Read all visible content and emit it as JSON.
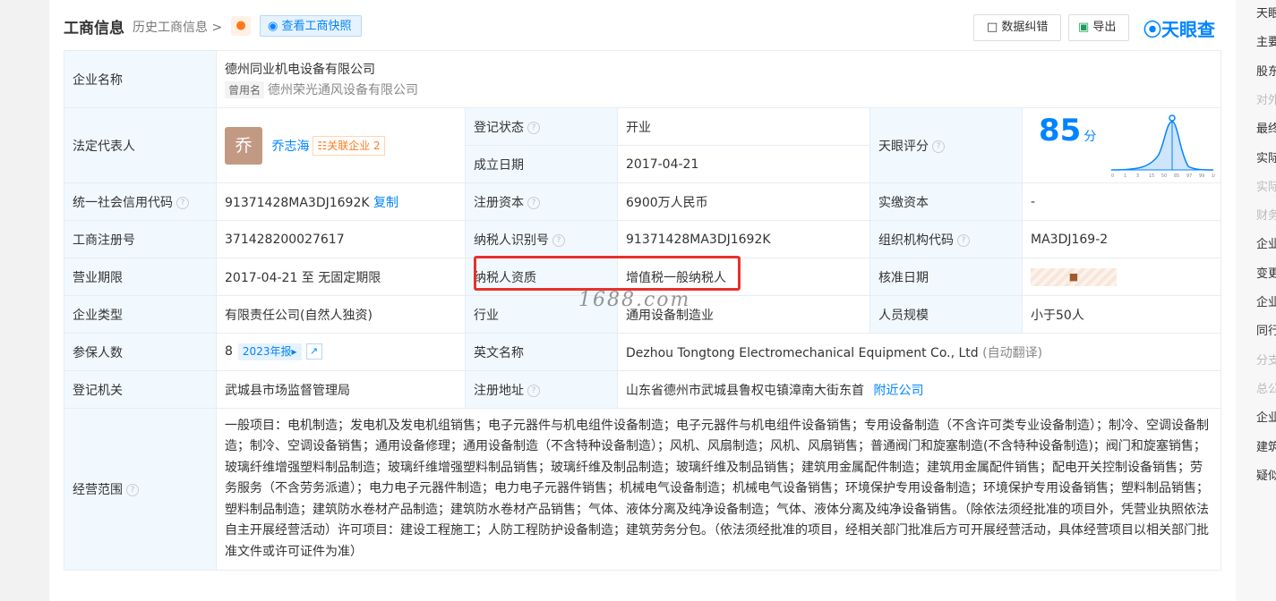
{
  "header": {
    "title": "工商信息",
    "history": "历史工商信息 >",
    "snapshot_label": "查看工商快照",
    "correction_label": "数据纠错",
    "export_label": "导出",
    "brand": "天眼查"
  },
  "company": {
    "name_label": "企业名称",
    "name": "德州同业机电设备有限公司",
    "former_tag": "曾用名",
    "former_name": "德州荣光通风设备有限公司",
    "legal_rep_label": "法定代表人",
    "legal_rep_avatar": "乔",
    "legal_rep": "乔志海",
    "assoc_label": "关联企业 2",
    "status_label": "登记状态",
    "status": "开业",
    "found_label": "成立日期",
    "found": "2017-04-21",
    "score_label": "天眼评分",
    "score": "85",
    "score_unit": "分",
    "credit_label": "统一社会信用代码",
    "credit": "91371428MA3DJ1692K",
    "copy": "复制",
    "capital_label": "注册资本",
    "capital": "6900万人民币",
    "paid_label": "实缴资本",
    "paid": "-",
    "reg_no_label": "工商注册号",
    "reg_no": "371428200027617",
    "tax_id_label": "纳税人识别号",
    "tax_id": "91371428MA3DJ1692K",
    "org_code_label": "组织机构代码",
    "org_code": "MA3DJ169-2",
    "term_label": "营业期限",
    "term": "2017-04-21 至 无固定期限",
    "taxpayer_label": "纳税人资质",
    "taxpayer": "增值税一般纳税人",
    "approve_label": "核准日期",
    "type_label": "企业类型",
    "type": "有限责任公司(自然人独资)",
    "industry_label": "行业",
    "industry": "通用设备制造业",
    "staff_label": "人员规模",
    "staff": "小于50人",
    "insured_label": "参保人数",
    "insured": "8",
    "year_report": "2023年报",
    "en_label": "英文名称",
    "en_name": "Dezhou Tongtong Electromechanical Equipment Co., Ltd",
    "auto_translate": "(自动翻译)",
    "authority_label": "登记机关",
    "authority": "武城县市场监督管理局",
    "address_label": "注册地址",
    "address": "山东省德州市武城县鲁权屯镇漳南大街东首",
    "nearby": "附近公司",
    "scope_label": "经营范围",
    "scope": "一般项目：电机制造；发电机及发电机组销售；电子元器件与机电组件设备制造；电子元器件与机电组件设备销售；专用设备制造（不含许可类专业设备制造）；制冷、空调设备制造；制冷、空调设备销售；通用设备修理；通用设备制造（不含特种设备制造）；风机、风扇制造；风机、风扇销售；普通阀门和旋塞制造(不含特种设备制造)；阀门和旋塞销售；玻璃纤维增强塑料制品制造；玻璃纤维增强塑料制品销售；玻璃纤维及制品制造；玻璃纤维及制品销售；建筑用金属配件制造；建筑用金属配件销售；配电开关控制设备销售；劳务服务（不含劳务派遣）；电力电子元器件制造；电力电子元器件销售；机械电气设备制造；机械电气设备销售；环境保护专用设备制造；环境保护专用设备销售；塑料制品销售；塑料制品制造；建筑防水卷材产品制造；建筑防水卷材产品销售；气体、液体分离及纯净设备制造；气体、液体分离及纯净设备销售。（除依法须经批准的项目外，凭营业执照依法自主开展经营活动）许可项目：建设工程施工；人防工程防护设备制造；建筑劳务分包。（依法须经批准的项目，经相关部门批准后方可开展经营活动，具体经营项目以相关部门批准文件或许可证件为准）"
  },
  "score_axis": [
    "0",
    "1",
    "3",
    "15",
    "50",
    "85",
    "97",
    "99",
    "100"
  ],
  "score_level": 85,
  "watermark": "1688.com",
  "rail": [
    {
      "t": "天眼",
      "dim": false
    },
    {
      "t": "主要",
      "dim": false
    },
    {
      "t": "股东",
      "dim": false
    },
    {
      "t": "对外",
      "dim": true
    },
    {
      "t": "最终",
      "dim": false
    },
    {
      "t": "实际",
      "dim": false
    },
    {
      "t": "实际",
      "dim": true
    },
    {
      "t": "财务",
      "dim": true
    },
    {
      "t": "企业",
      "dim": false
    },
    {
      "t": "变更",
      "dim": false
    },
    {
      "t": "企业",
      "dim": false
    },
    {
      "t": "同行",
      "dim": false
    },
    {
      "t": "分支",
      "dim": true
    },
    {
      "t": "总公",
      "dim": true
    },
    {
      "t": "企业",
      "dim": false
    },
    {
      "t": "建筑",
      "dim": false
    },
    {
      "t": "疑似",
      "dim": false
    }
  ],
  "colors": {
    "accent": "#0084ff",
    "label_bg": "#f2f9fe",
    "highlight": "#e8302c"
  }
}
